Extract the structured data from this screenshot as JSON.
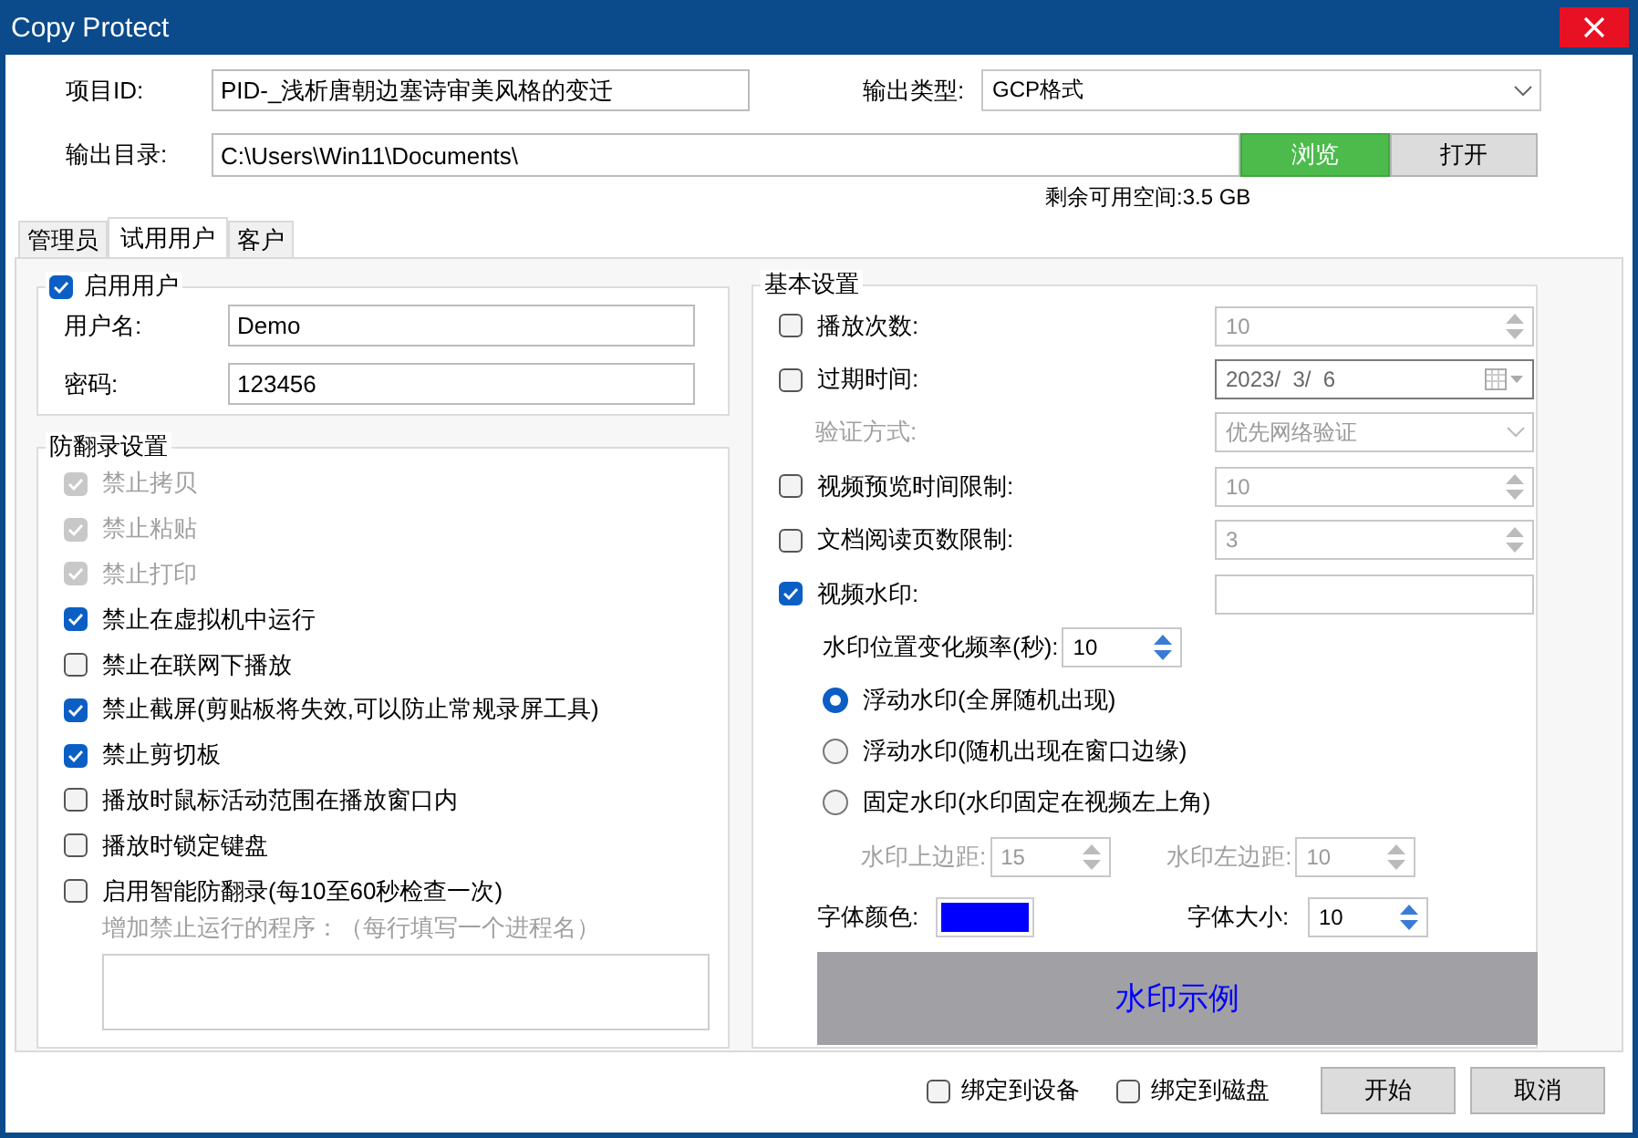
{
  "window": {
    "title": "Copy Protect"
  },
  "header": {
    "project_id": {
      "label": "项目ID:",
      "value": "PID-_浅析唐朝边塞诗审美风格的变迁"
    },
    "output_type": {
      "label": "输出类型:",
      "value": "GCP格式"
    },
    "output_dir": {
      "label": "输出目录:",
      "value": "C:\\Users\\Win11\\Documents\\"
    },
    "buttons": [
      {
        "label": "浏览",
        "kind": "primary"
      },
      {
        "label": "打开",
        "kind": "normal"
      }
    ],
    "free_space": "剩余可用空间:3.5 GB"
  },
  "tabs": [
    {
      "label": "管理员",
      "selected": false
    },
    {
      "label": "试用用户",
      "selected": true
    },
    {
      "label": "客户",
      "selected": false
    }
  ],
  "user_group": {
    "title": "启用用户",
    "checked": true,
    "fields": [
      {
        "label": "用户名:",
        "value": "Demo"
      },
      {
        "label": "密码:",
        "value": "123456"
      }
    ]
  },
  "anti_record": {
    "title": "防翻录设置",
    "options": [
      {
        "label": "禁止拷贝",
        "checked": true,
        "disabled": true
      },
      {
        "label": "禁止粘贴",
        "checked": true,
        "disabled": true
      },
      {
        "label": "禁止打印",
        "checked": true,
        "disabled": true
      },
      {
        "label": "禁止在虚拟机中运行",
        "checked": true,
        "disabled": false
      },
      {
        "label": "禁止在联网下播放",
        "checked": false,
        "disabled": false
      },
      {
        "label": "禁止截屏(剪贴板将失效,可以防止常规录屏工具)",
        "checked": true,
        "disabled": false
      },
      {
        "label": "禁止剪切板",
        "checked": true,
        "disabled": false
      },
      {
        "label": "播放时鼠标活动范围在播放窗口内",
        "checked": false,
        "disabled": false
      },
      {
        "label": "播放时锁定键盘",
        "checked": false,
        "disabled": false
      },
      {
        "label": "启用智能防翻录(每10至60秒检查一次)",
        "checked": false,
        "disabled": false
      }
    ],
    "program_hint": "增加禁止运行的程序：（每行填写一个进程名）"
  },
  "basic": {
    "title": "基本设置",
    "rows": [
      {
        "kind": "check",
        "label": "播放次数:",
        "checked": false,
        "field": {
          "kind": "spin",
          "value": "10",
          "disabled": true
        }
      },
      {
        "kind": "check",
        "label": "过期时间:",
        "checked": false,
        "field": {
          "kind": "date",
          "value": "2023/  3/  6",
          "disabled": true
        }
      },
      {
        "kind": "label",
        "label": "验证方式:",
        "field": {
          "kind": "select",
          "value": "优先网络验证",
          "disabled": true
        }
      },
      {
        "kind": "check",
        "label": "视频预览时间限制:",
        "checked": false,
        "field": {
          "kind": "spin",
          "value": "10",
          "disabled": true
        }
      },
      {
        "kind": "check",
        "label": "文档阅读页数限制:",
        "checked": false,
        "field": {
          "kind": "spin",
          "value": "3",
          "disabled": true
        }
      },
      {
        "kind": "check",
        "label": "视频水印:",
        "checked": true,
        "field": {
          "kind": "text"
        }
      }
    ]
  },
  "watermark": {
    "interval": {
      "label": "水印位置变化频率(秒):",
      "value": "10"
    },
    "modes": [
      {
        "label": "浮动水印(全屏随机出现)",
        "selected": true
      },
      {
        "label": "浮动水印(随机出现在窗口边缘)",
        "selected": false
      },
      {
        "label": "固定水印(水印固定在视频左上角)",
        "selected": false
      }
    ],
    "margins": [
      {
        "label": "水印上边距:",
        "value": "15",
        "disabled": true
      },
      {
        "label": "水印左边距:",
        "value": "10",
        "disabled": true
      }
    ],
    "font_color": {
      "label": "字体颜色:",
      "color": "#0000ff"
    },
    "font_size": {
      "label": "字体大小:",
      "value": "10"
    },
    "preview": "水印示例"
  },
  "footer": {
    "bindings": [
      {
        "label": "绑定到设备",
        "checked": false
      },
      {
        "label": "绑定到磁盘",
        "checked": false
      }
    ],
    "buttons": [
      "开始",
      "取消"
    ]
  }
}
